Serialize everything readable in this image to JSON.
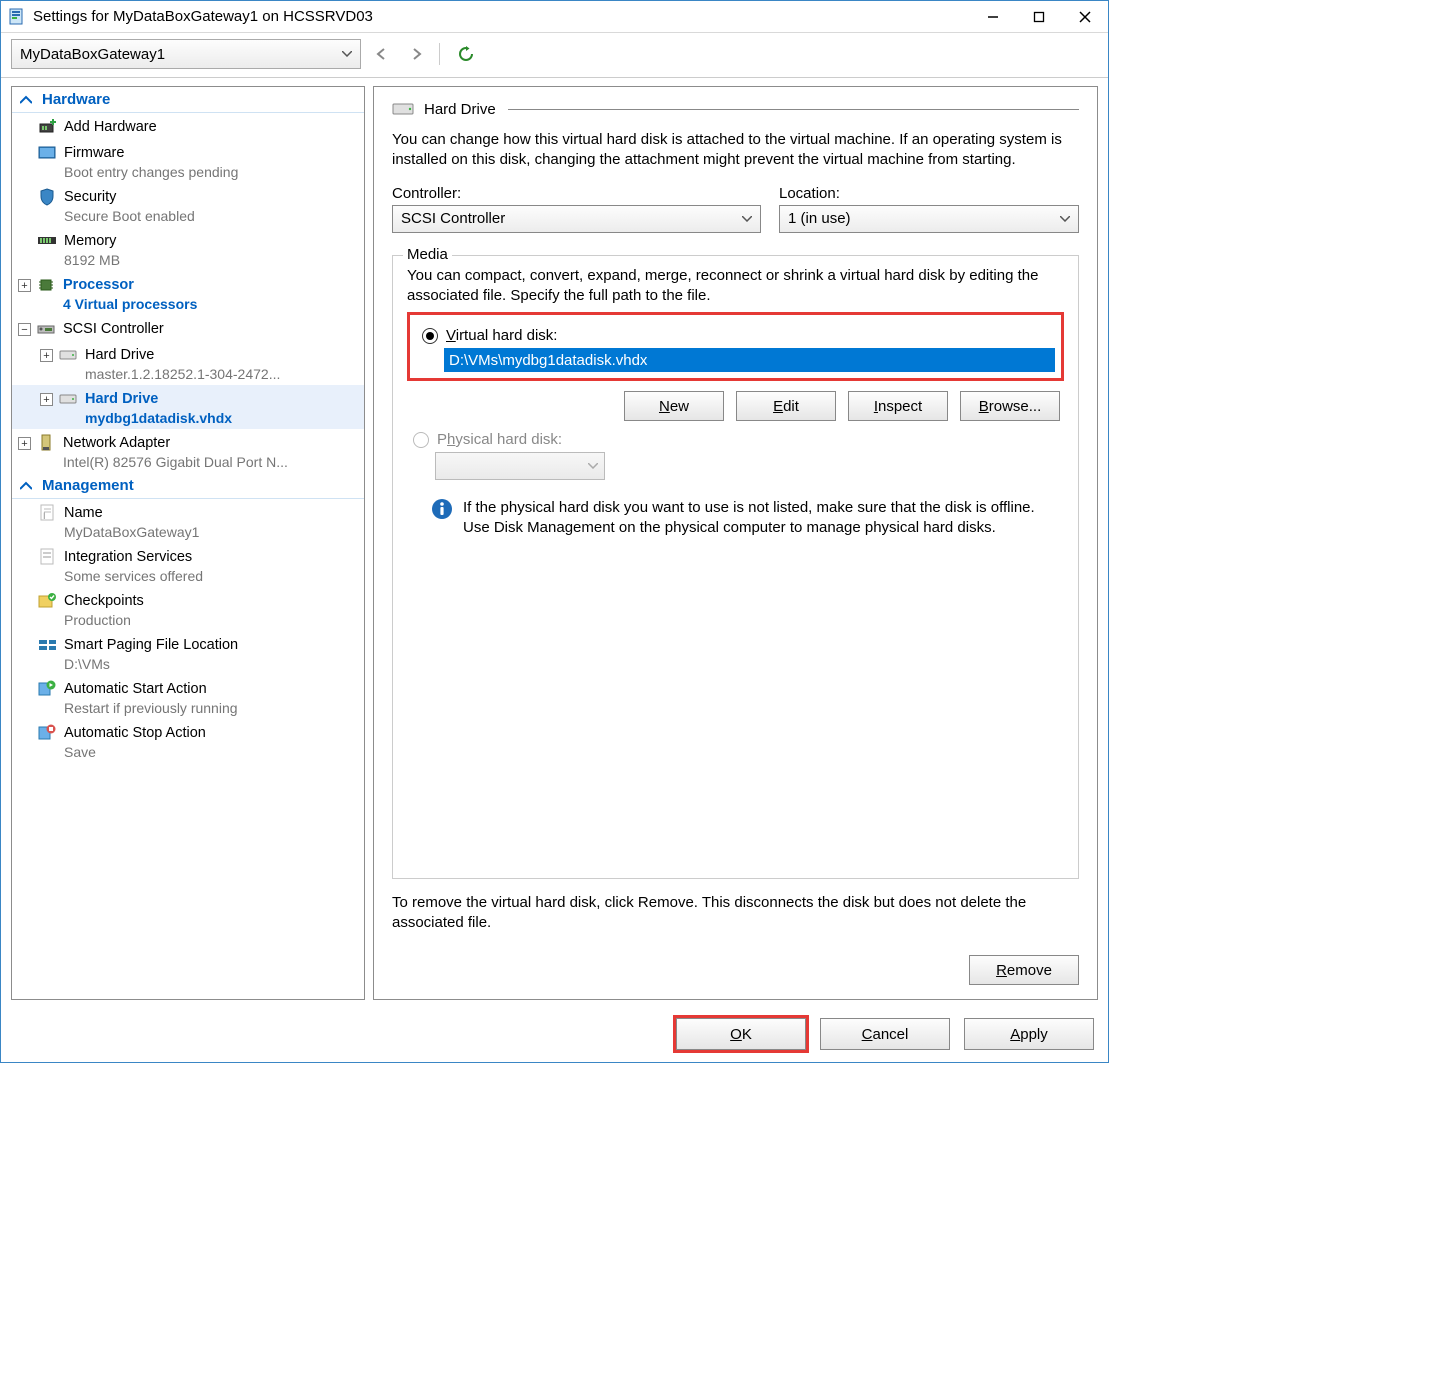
{
  "window": {
    "title": "Settings for MyDataBoxGateway1 on HCSSRVD03"
  },
  "toolbar": {
    "vm_name": "MyDataBoxGateway1"
  },
  "sidebar": {
    "hardware_label": "Hardware",
    "management_label": "Management",
    "items": {
      "add_hardware": {
        "label": "Add Hardware"
      },
      "firmware": {
        "label": "Firmware",
        "sub": "Boot entry changes pending"
      },
      "security": {
        "label": "Security",
        "sub": "Secure Boot enabled"
      },
      "memory": {
        "label": "Memory",
        "sub": "8192 MB"
      },
      "processor": {
        "label": "Processor",
        "sub": "4 Virtual processors"
      },
      "scsi": {
        "label": "SCSI Controller"
      },
      "hd1": {
        "label": "Hard Drive",
        "sub": "master.1.2.18252.1-304-2472..."
      },
      "hd2": {
        "label": "Hard Drive",
        "sub": "mydbg1datadisk.vhdx"
      },
      "netadapter": {
        "label": "Network Adapter",
        "sub": "Intel(R) 82576 Gigabit Dual Port N..."
      },
      "name": {
        "label": "Name",
        "sub": "MyDataBoxGateway1"
      },
      "integ": {
        "label": "Integration Services",
        "sub": "Some services offered"
      },
      "checkpoints": {
        "label": "Checkpoints",
        "sub": "Production"
      },
      "paging": {
        "label": "Smart Paging File Location",
        "sub": "D:\\VMs"
      },
      "autostart": {
        "label": "Automatic Start Action",
        "sub": "Restart if previously running"
      },
      "autostop": {
        "label": "Automatic Stop Action",
        "sub": "Save"
      }
    }
  },
  "content": {
    "header": "Hard Drive",
    "desc": "You can change how this virtual hard disk is attached to the virtual machine. If an operating system is installed on this disk, changing the attachment might prevent the virtual machine from starting.",
    "controller_label": "Controller:",
    "controller_value": "SCSI Controller",
    "location_label": "Location:",
    "location_value": "1 (in use)",
    "media_legend": "Media",
    "media_desc": "You can compact, convert, expand, merge, reconnect or shrink a virtual hard disk by editing the associated file. Specify the full path to the file.",
    "vhd_radio_label": "Virtual hard disk:",
    "vhd_path": "D:\\VMs\\mydbg1datadisk.vhdx",
    "btn_new": "New",
    "btn_edit": "Edit",
    "btn_inspect": "Inspect",
    "btn_browse": "Browse...",
    "phys_radio_label": "Physical hard disk:",
    "phys_info": "If the physical hard disk you want to use is not listed, make sure that the disk is offline. Use Disk Management on the physical computer to manage physical hard disks.",
    "remove_desc": "To remove the virtual hard disk, click Remove. This disconnects the disk but does not delete the associated file.",
    "btn_remove": "Remove"
  },
  "footer": {
    "ok": "OK",
    "cancel": "Cancel",
    "apply": "Apply"
  }
}
